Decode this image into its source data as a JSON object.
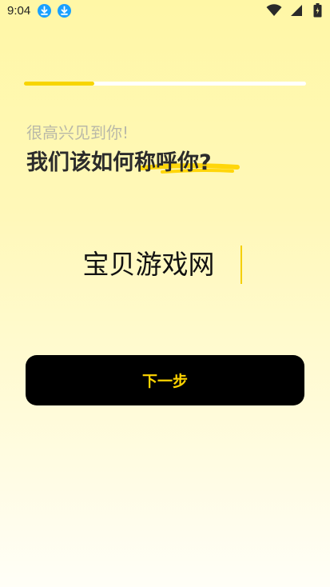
{
  "status_bar": {
    "time": "9:04",
    "icons": [
      "download-icon",
      "download-icon",
      "wifi-icon",
      "cell-signal-icon",
      "battery-icon"
    ]
  },
  "progress": {
    "fraction": 0.25,
    "fill_color": "#f7d500",
    "track_color": "#ffffff"
  },
  "greeting": "很高兴见到你!",
  "question": "我们该如何称呼你?",
  "name_input": {
    "value": "宝贝游戏网",
    "caret_color": "#f4cf00"
  },
  "next_button": {
    "label": "下一步",
    "bg_color": "#000000",
    "text_color": "#ffd400"
  },
  "colors": {
    "accent": "#f7d500",
    "bg_top": "#fff7a6",
    "bg_bottom": "#fffef7"
  }
}
